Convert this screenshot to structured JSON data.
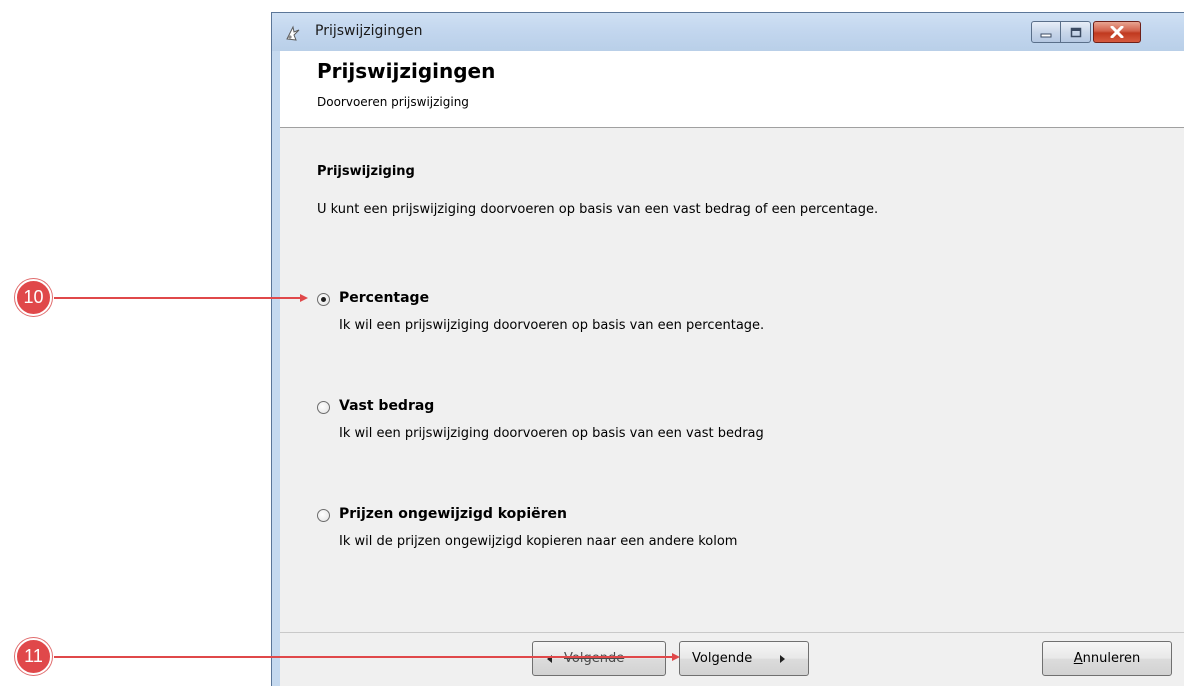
{
  "window": {
    "title": "Prijswijzigingen"
  },
  "header": {
    "title": "Prijswijzigingen",
    "subtitle": "Doorvoeren prijswijziging"
  },
  "content": {
    "section_title": "Prijswijziging",
    "intro": "U kunt een prijswijziging doorvoeren op basis van een vast bedrag of een percentage.",
    "options": [
      {
        "label": "Percentage",
        "description": "Ik wil een prijswijziging doorvoeren op basis van een percentage.",
        "selected": true
      },
      {
        "label": "Vast bedrag",
        "description": "Ik wil een prijswijziging doorvoeren op basis van een vast bedrag",
        "selected": false
      },
      {
        "label": "Prijzen ongewijzigd kopiëren",
        "description": "Ik wil de prijzen ongewijzigd kopieren naar een andere kolom",
        "selected": false
      }
    ]
  },
  "footer": {
    "back_label": "Volgende",
    "next_label": "Volgende",
    "cancel_label_accel": "A",
    "cancel_label_rest": "nnuleren"
  },
  "annotations": [
    {
      "number": "10"
    },
    {
      "number": "11"
    }
  ],
  "colors": {
    "callout": "#e0484a",
    "window_frame": "#c5d9ef",
    "client_bg": "#f0f0f0",
    "close_button": "#c0391f"
  },
  "icons": {
    "app": "wizard-app-icon",
    "minimize": "minimize-icon",
    "maximize": "maximize-icon",
    "close": "close-icon"
  }
}
